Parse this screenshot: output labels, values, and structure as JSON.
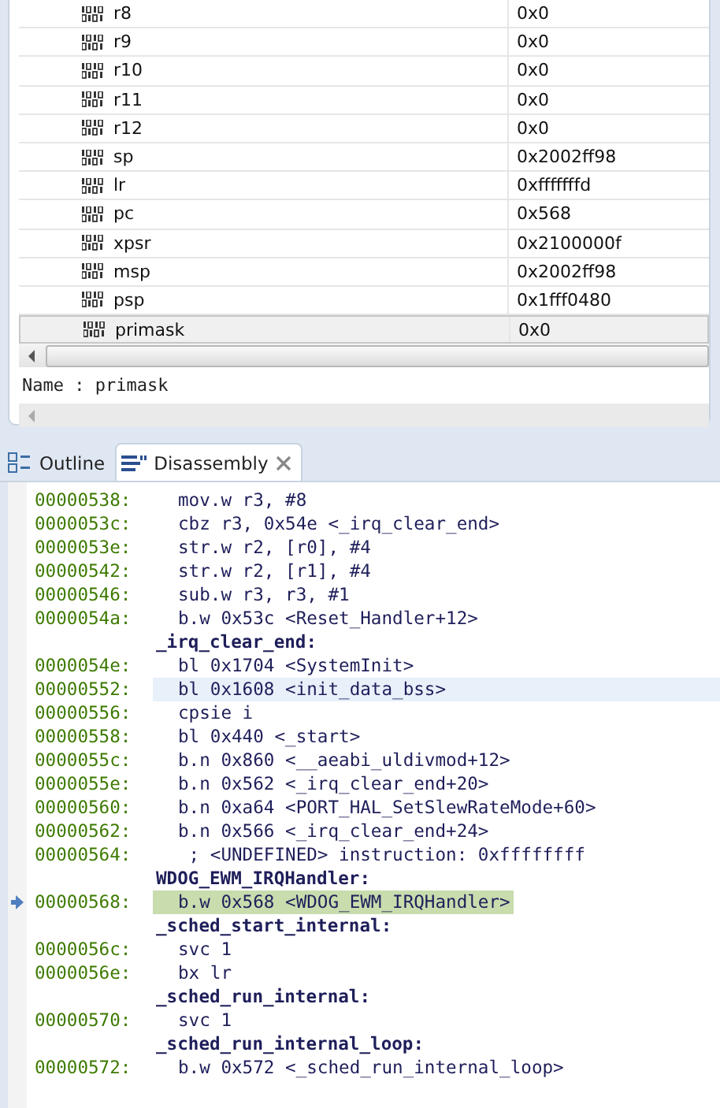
{
  "registers": [
    {
      "name": "r8",
      "value": "0x0",
      "selected": false
    },
    {
      "name": "r9",
      "value": "0x0",
      "selected": false
    },
    {
      "name": "r10",
      "value": "0x0",
      "selected": false
    },
    {
      "name": "r11",
      "value": "0x0",
      "selected": false
    },
    {
      "name": "r12",
      "value": "0x0",
      "selected": false
    },
    {
      "name": "sp",
      "value": "0x2002ff98",
      "selected": false
    },
    {
      "name": "lr",
      "value": "0xfffffffd",
      "selected": false
    },
    {
      "name": "pc",
      "value": "0x568",
      "selected": false
    },
    {
      "name": "xpsr",
      "value": "0x2100000f",
      "selected": false
    },
    {
      "name": "msp",
      "value": "0x2002ff98",
      "selected": false
    },
    {
      "name": "psp",
      "value": "0x1fff0480",
      "selected": false
    },
    {
      "name": "primask",
      "value": "0x0",
      "selected": true
    }
  ],
  "detail": "Name : primask",
  "tabs": [
    {
      "label": "Outline",
      "selected": false
    },
    {
      "label": "Disassembly",
      "selected": true
    }
  ],
  "disassembly": [
    {
      "kind": "instr",
      "address": "00000538:",
      "text": "mov.w r3, #8",
      "current": false,
      "cursor": false
    },
    {
      "kind": "instr",
      "address": "0000053c:",
      "text": "cbz r3, 0x54e <_irq_clear_end>",
      "current": false,
      "cursor": false
    },
    {
      "kind": "instr",
      "address": "0000053e:",
      "text": "str.w r2, [r0], #4",
      "current": false,
      "cursor": false
    },
    {
      "kind": "instr",
      "address": "00000542:",
      "text": "str.w r2, [r1], #4",
      "current": false,
      "cursor": false
    },
    {
      "kind": "instr",
      "address": "00000546:",
      "text": "sub.w r3, r3, #1",
      "current": false,
      "cursor": false
    },
    {
      "kind": "instr",
      "address": "0000054a:",
      "text": "b.w 0x53c <Reset_Handler+12>",
      "current": false,
      "cursor": false
    },
    {
      "kind": "label",
      "text": "_irq_clear_end:"
    },
    {
      "kind": "instr",
      "address": "0000054e:",
      "text": "bl 0x1704 <SystemInit>",
      "current": false,
      "cursor": false
    },
    {
      "kind": "instr",
      "address": "00000552:",
      "text": "bl 0x1608 <init_data_bss>",
      "current": false,
      "cursor": true
    },
    {
      "kind": "instr",
      "address": "00000556:",
      "text": "cpsie i",
      "current": false,
      "cursor": false
    },
    {
      "kind": "instr",
      "address": "00000558:",
      "text": "bl 0x440 <_start>",
      "current": false,
      "cursor": false
    },
    {
      "kind": "instr",
      "address": "0000055c:",
      "text": "b.n 0x860 <__aeabi_uldivmod+12>",
      "current": false,
      "cursor": false
    },
    {
      "kind": "instr",
      "address": "0000055e:",
      "text": "b.n 0x562 <_irq_clear_end+20>",
      "current": false,
      "cursor": false
    },
    {
      "kind": "instr",
      "address": "00000560:",
      "text": "b.n 0xa64 <PORT_HAL_SetSlewRateMode+60>",
      "current": false,
      "cursor": false
    },
    {
      "kind": "instr",
      "address": "00000562:",
      "text": "b.n 0x566 <_irq_clear_end+24>",
      "current": false,
      "cursor": false
    },
    {
      "kind": "instr",
      "address": "00000564:",
      "text": " ; <UNDEFINED> instruction: 0xffffffff",
      "current": false,
      "cursor": false
    },
    {
      "kind": "label",
      "text": "WDOG_EWM_IRQHandler:"
    },
    {
      "kind": "instr",
      "address": "00000568:",
      "text": "b.w 0x568 <WDOG_EWM_IRQHandler>",
      "current": true,
      "cursor": false
    },
    {
      "kind": "label",
      "text": "_sched_start_internal:"
    },
    {
      "kind": "instr",
      "address": "0000056c:",
      "text": "svc 1",
      "current": false,
      "cursor": false
    },
    {
      "kind": "instr",
      "address": "0000056e:",
      "text": "bx lr",
      "current": false,
      "cursor": false
    },
    {
      "kind": "label",
      "text": "_sched_run_internal:"
    },
    {
      "kind": "instr",
      "address": "00000570:",
      "text": "svc 1",
      "current": false,
      "cursor": false
    },
    {
      "kind": "label",
      "text": "_sched_run_internal_loop:"
    },
    {
      "kind": "instr",
      "address": "00000572:",
      "text": "b.w 0x572 <_sched_run_internal_loop>",
      "current": false,
      "cursor": false
    }
  ]
}
